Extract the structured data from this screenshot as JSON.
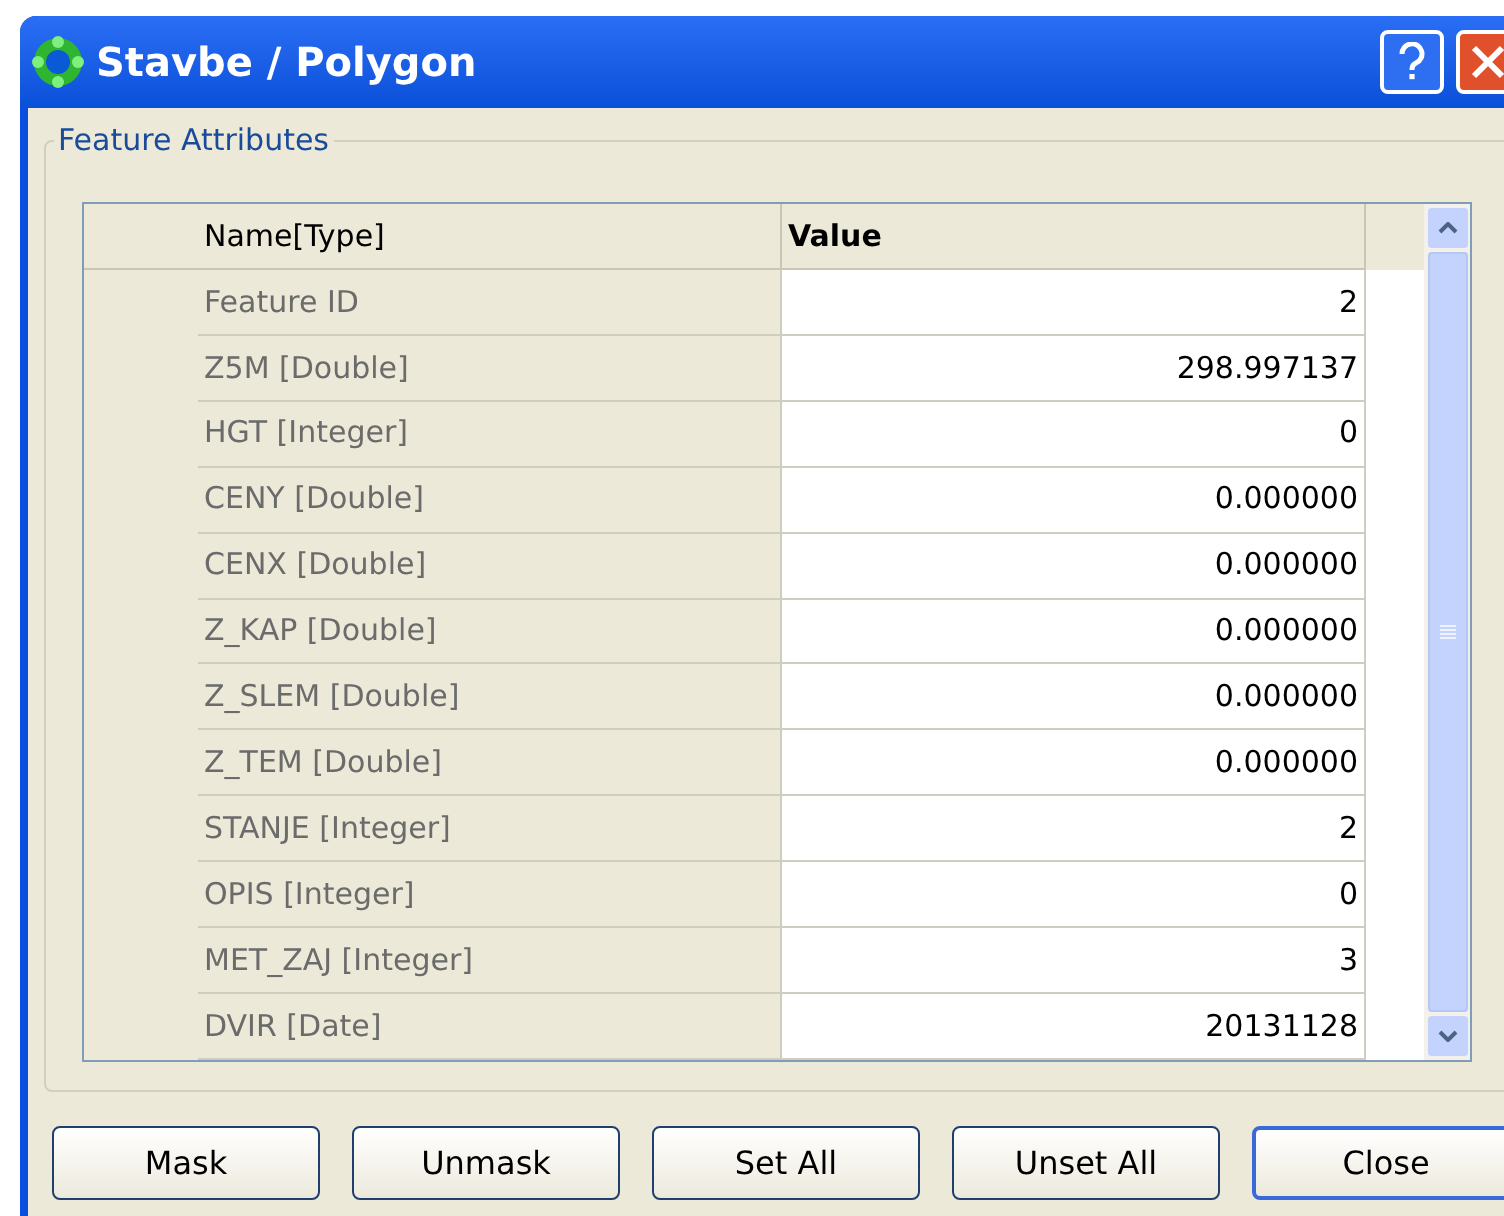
{
  "window": {
    "title": "Stavbe / Polygon"
  },
  "group": {
    "title": "Feature Attributes"
  },
  "table": {
    "columns": [
      "Name[Type]",
      "Value"
    ],
    "rows": [
      {
        "name": "Feature ID",
        "value": "2"
      },
      {
        "name": "Z5M [Double]",
        "value": "298.997137"
      },
      {
        "name": "HGT [Integer]",
        "value": "0"
      },
      {
        "name": "CENY [Double]",
        "value": "0.000000"
      },
      {
        "name": "CENX [Double]",
        "value": "0.000000"
      },
      {
        "name": "Z_KAP [Double]",
        "value": "0.000000"
      },
      {
        "name": "Z_SLEM [Double]",
        "value": "0.000000"
      },
      {
        "name": "Z_TEM [Double]",
        "value": "0.000000"
      },
      {
        "name": "STANJE [Integer]",
        "value": "2"
      },
      {
        "name": "OPIS [Integer]",
        "value": "0"
      },
      {
        "name": "MET_ZAJ [Integer]",
        "value": "3"
      },
      {
        "name": "DVIR [Date]",
        "value": "20131128"
      }
    ]
  },
  "buttons": [
    {
      "label": "Mask",
      "default": false
    },
    {
      "label": "Unmask",
      "default": false
    },
    {
      "label": "Set All",
      "default": false
    },
    {
      "label": "Unset All",
      "default": false
    },
    {
      "label": "Close",
      "default": true
    }
  ]
}
